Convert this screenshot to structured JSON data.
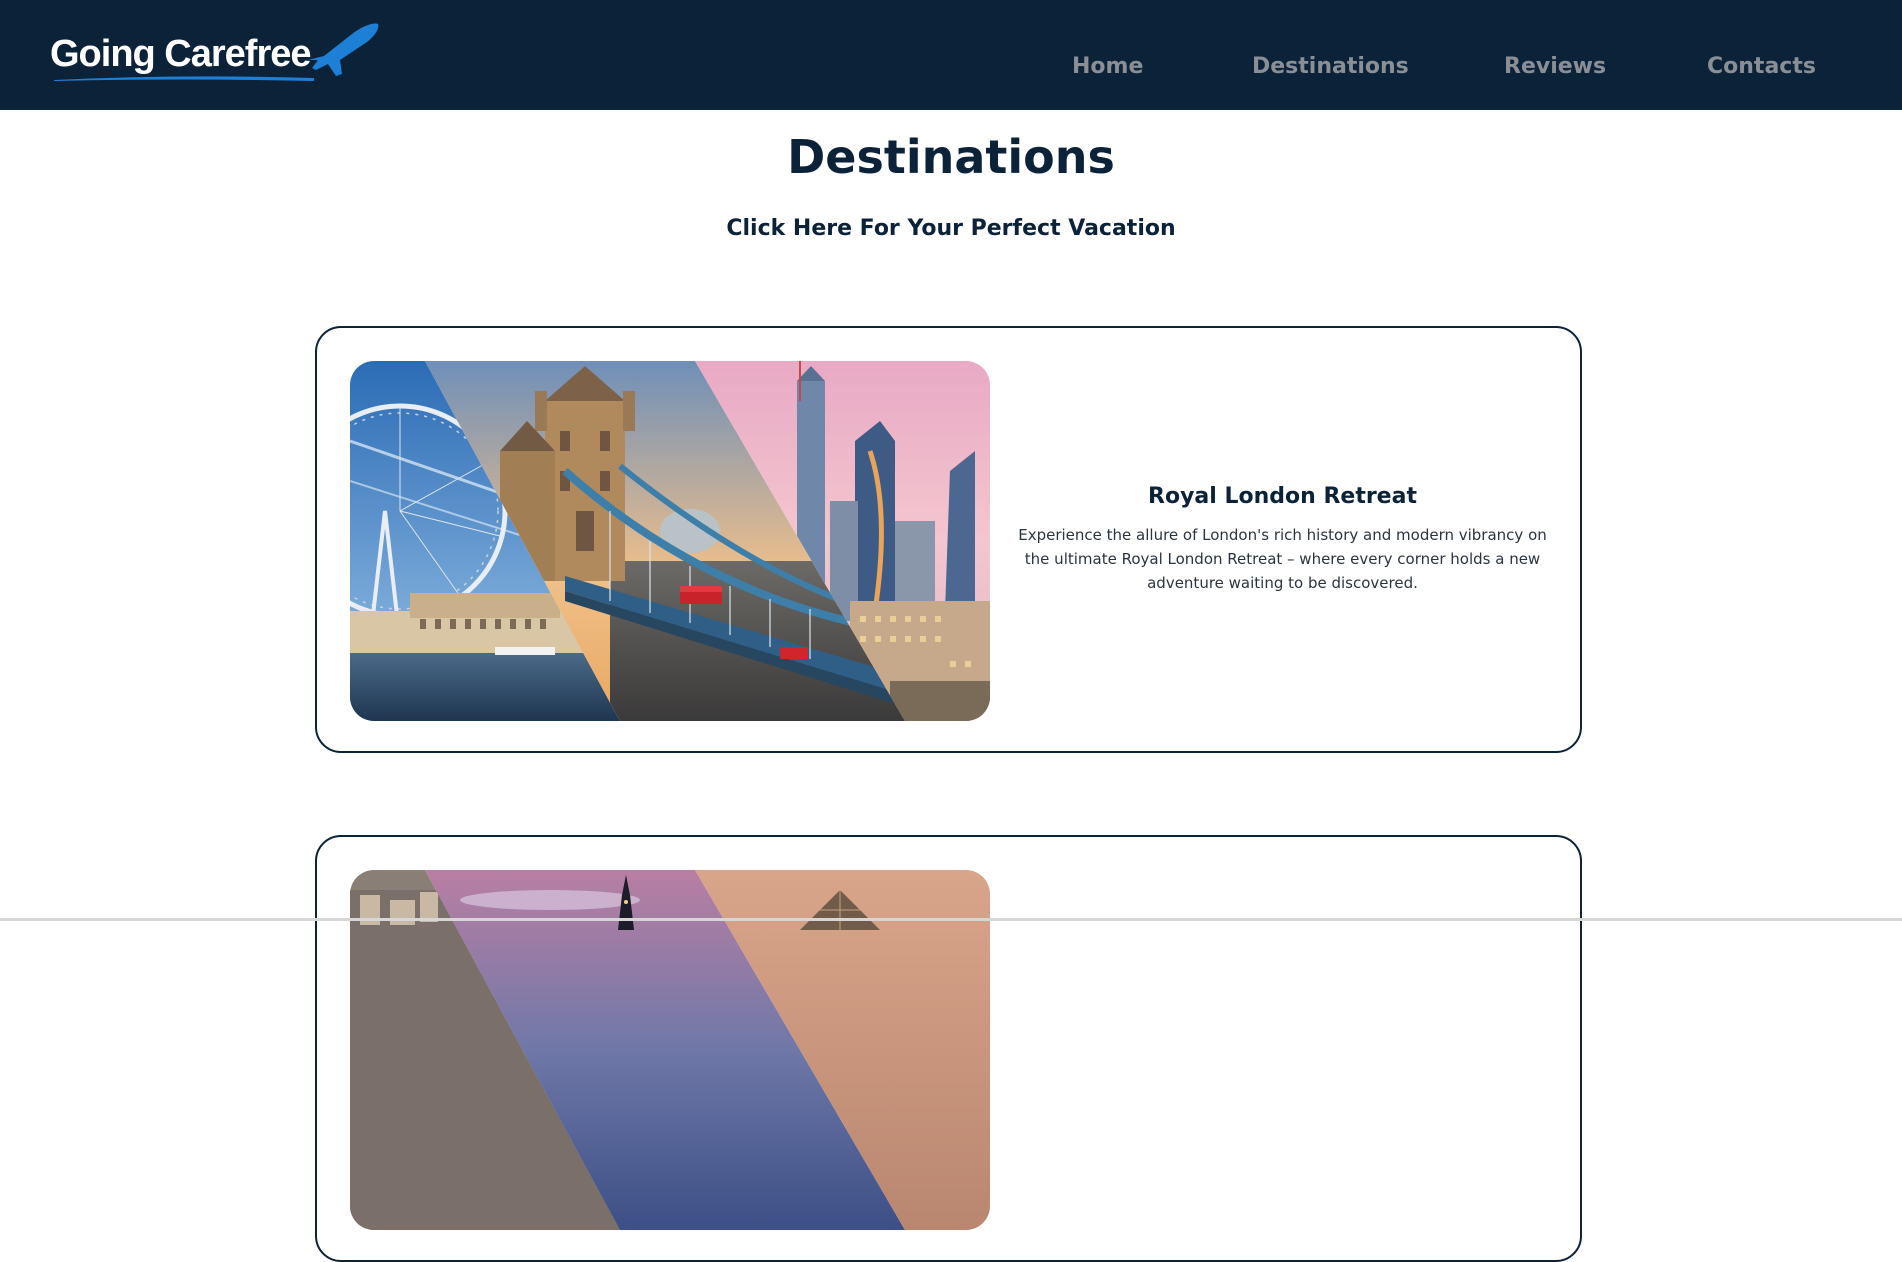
{
  "brand": {
    "name": "Going Carefree",
    "colors": {
      "navbar": "#0b2239",
      "accent": "#1e7fd6",
      "text": "#0b2238",
      "nav_link": "#8a8f95"
    }
  },
  "nav": {
    "items": [
      {
        "label": "Home"
      },
      {
        "label": "Destinations"
      },
      {
        "label": "Reviews"
      },
      {
        "label": "Contacts"
      }
    ]
  },
  "main": {
    "title": "Destinations",
    "subtitle": "Click Here For Your Perfect Vacation",
    "cards": [
      {
        "title": "Royal London Retreat",
        "description": "Experience the allure of London's rich history and modern vibrancy on the ultimate Royal London Retreat – where every corner holds a new adventure waiting to be discovered.",
        "image_icon": "london-collage-image"
      },
      {
        "title": "",
        "description": "",
        "image_icon": "paris-collage-image"
      }
    ]
  }
}
